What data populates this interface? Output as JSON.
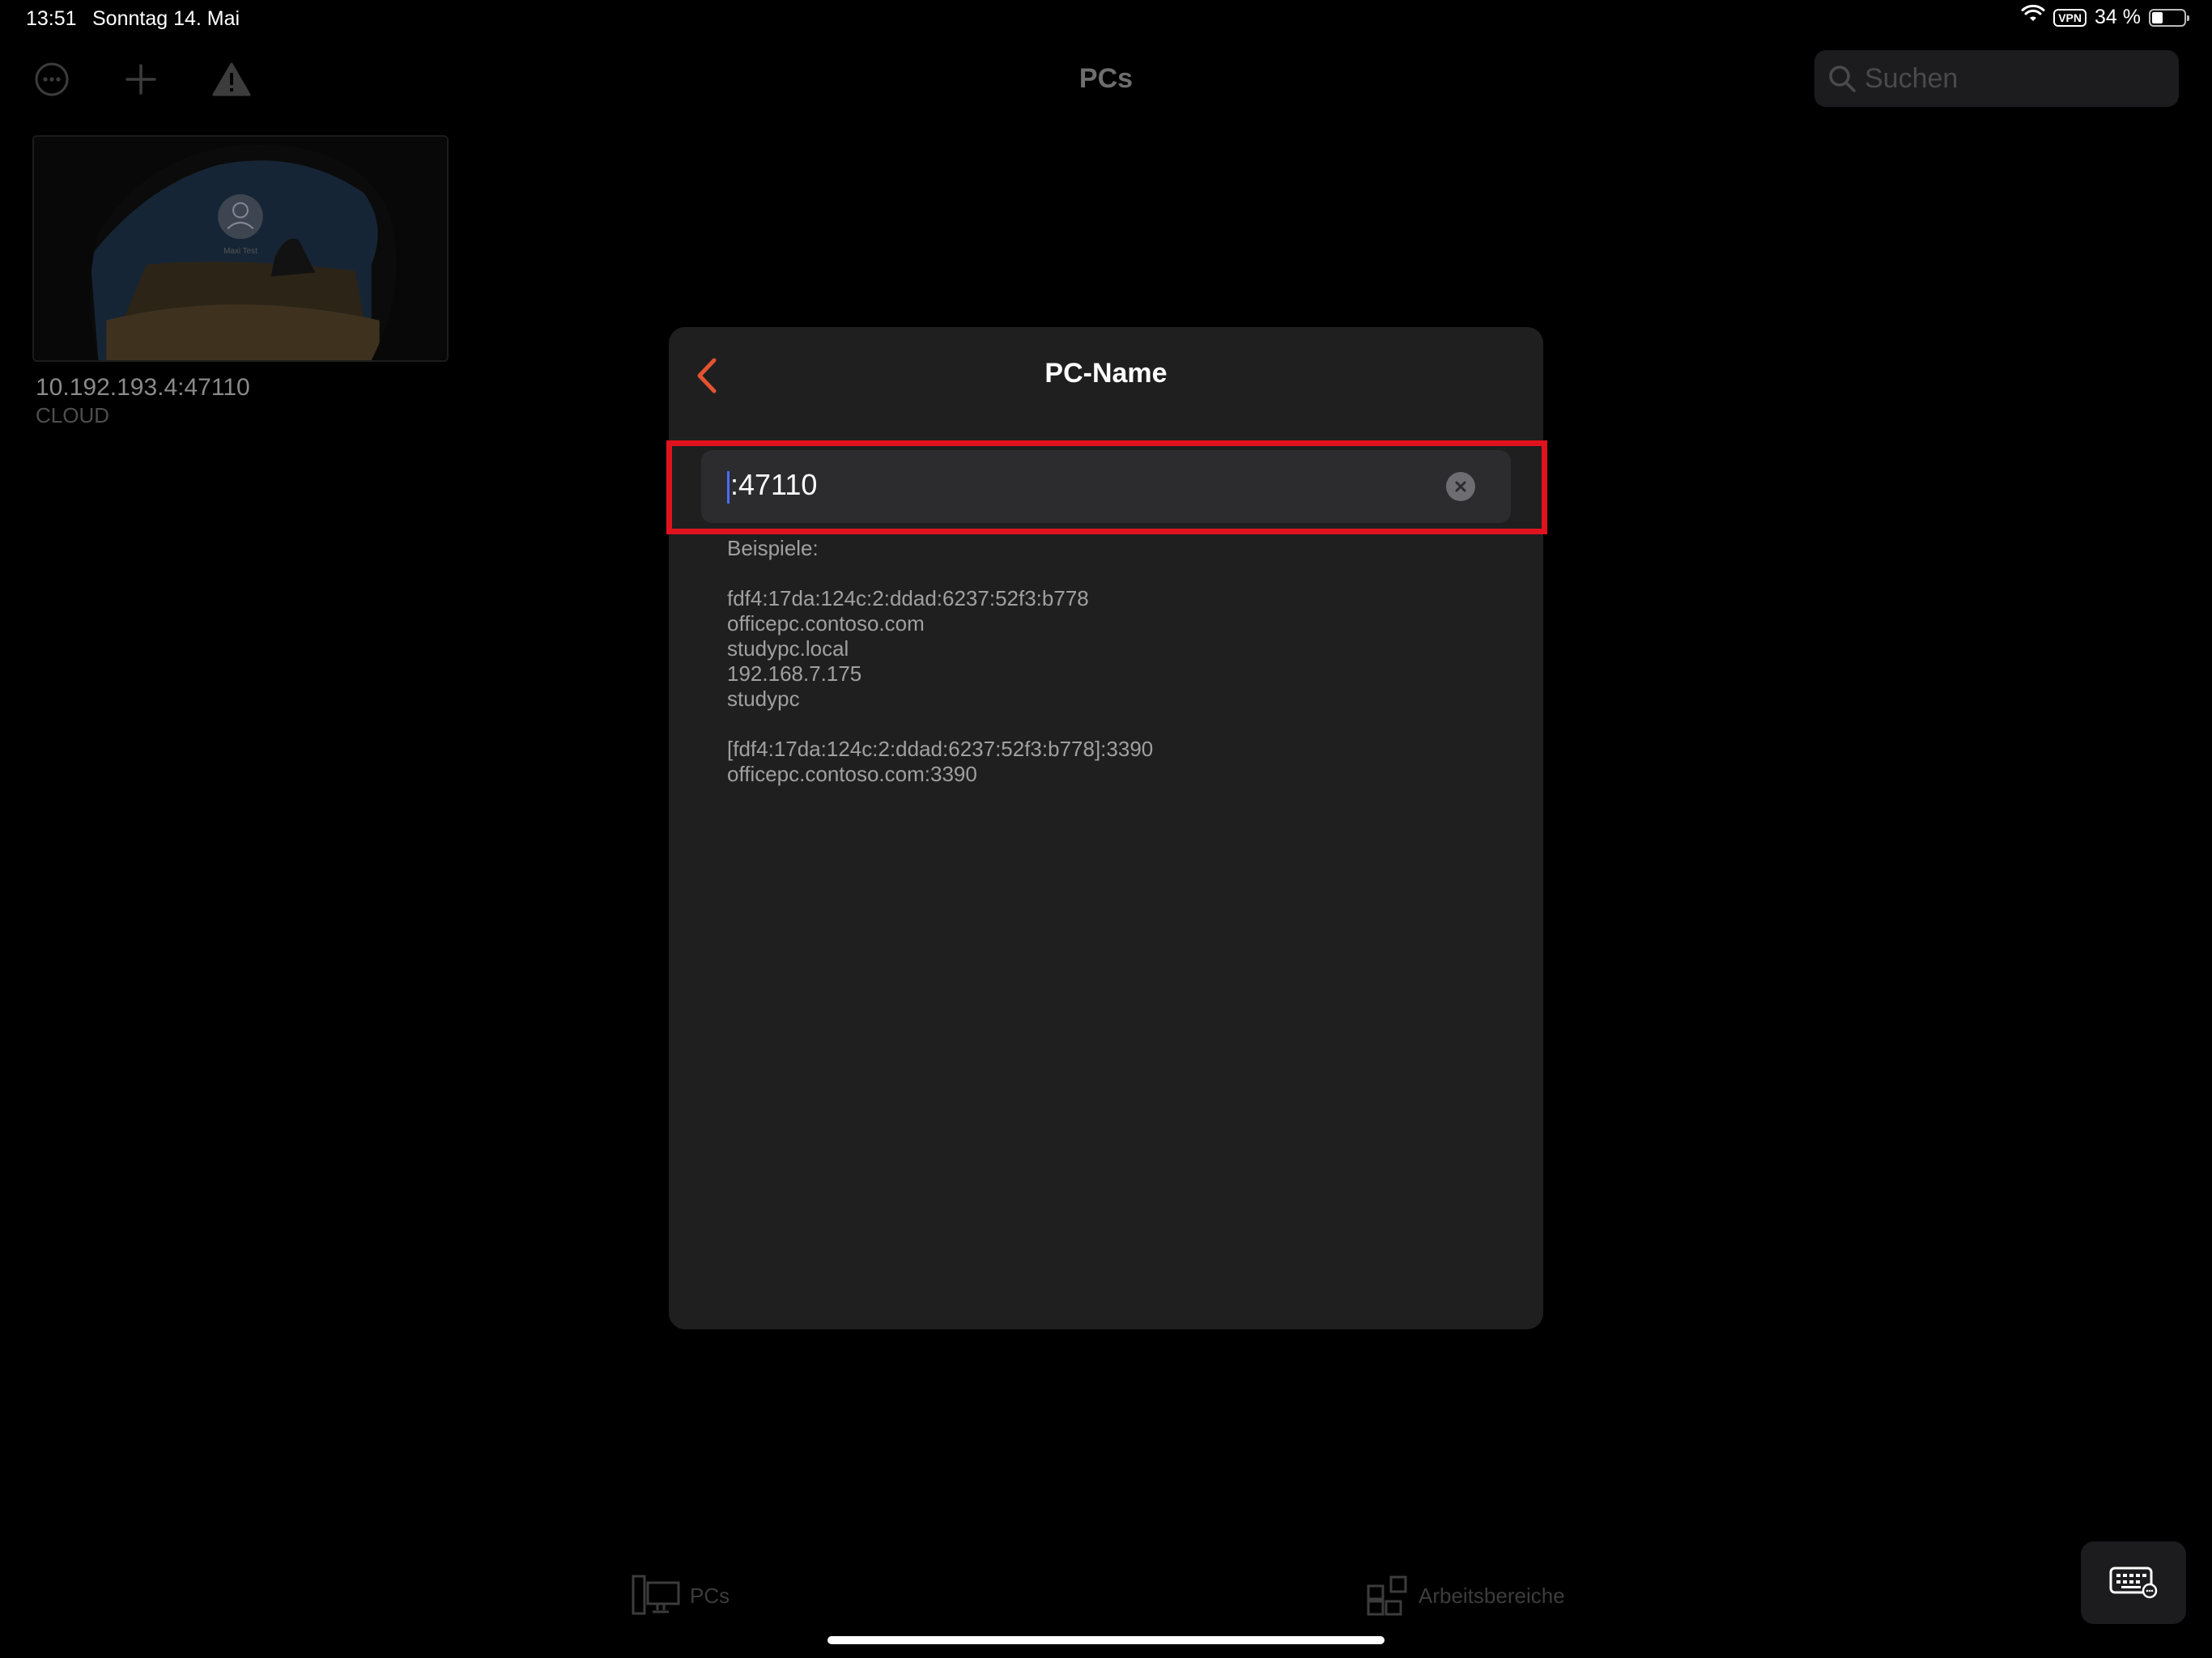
{
  "status_bar": {
    "time": "13:51",
    "date": "Sonntag 14. Mai",
    "vpn": "VPN",
    "battery": "34 %",
    "battery_level_percent": 34
  },
  "toolbar": {
    "title": "PCs",
    "search_placeholder": "Suchen"
  },
  "pc_list": [
    {
      "name": "10.192.193.4:47110",
      "subtitle": "CLOUD",
      "thumbnail_user": "Maxi Test"
    }
  ],
  "dialog": {
    "title": "PC-Name",
    "input_value": ":47110",
    "examples_heading": "Beispiele:",
    "examples_group1": [
      "fdf4:17da:124c:2:ddad:6237:52f3:b778",
      "officepc.contoso.com",
      "studypc.local",
      "192.168.7.175",
      "studypc"
    ],
    "examples_group2": [
      "[fdf4:17da:124c:2:ddad:6237:52f3:b778]:3390",
      "officepc.contoso.com:3390"
    ]
  },
  "tabs": [
    {
      "label": "PCs",
      "icon": "desktop-icon"
    },
    {
      "label": "Arbeitsbereiche",
      "icon": "workspaces-icon"
    }
  ],
  "colors": {
    "accent": "#e4522f",
    "highlight": "#e0121e",
    "modal_bg": "#1f1f1f",
    "input_bg": "#2c2c2e"
  }
}
